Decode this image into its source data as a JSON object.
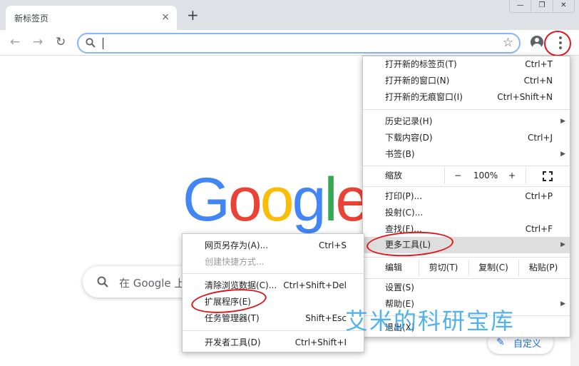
{
  "tab": {
    "title": "新标签页",
    "close": "×"
  },
  "newtab": "+",
  "window": {
    "minimize": "—",
    "restore": "❐",
    "close": "✕"
  },
  "nav": {
    "back": "←",
    "forward": "→",
    "reload": "↻",
    "star": "☆"
  },
  "page": {
    "logo": [
      "G",
      "o",
      "o",
      "g",
      "l",
      "e"
    ],
    "logo_colors": [
      "#4285f4",
      "#ea4335",
      "#fbbc05",
      "#4285f4",
      "#34a853",
      "#ea4335"
    ],
    "search_placeholder": "在 Google 上",
    "customize_label": "自定义",
    "customize_icon": "✎"
  },
  "menu": {
    "new_tab": {
      "label": "打开新的标签页(T)",
      "shortcut": "Ctrl+T"
    },
    "new_window": {
      "label": "打开新的窗口(N)",
      "shortcut": "Ctrl+N"
    },
    "incognito": {
      "label": "打开新的无痕窗口(I)",
      "shortcut": "Ctrl+Shift+N"
    },
    "history": {
      "label": "历史记录(H)"
    },
    "downloads": {
      "label": "下载内容(D)",
      "shortcut": "Ctrl+J"
    },
    "bookmarks": {
      "label": "书签(B)"
    },
    "zoom": {
      "label": "缩放",
      "minus": "−",
      "value": "100%",
      "plus": "+"
    },
    "print": {
      "label": "打印(P)...",
      "shortcut": "Ctrl+P"
    },
    "cast": {
      "label": "投射(C)..."
    },
    "find": {
      "label": "查找(F)...",
      "shortcut": "Ctrl+F"
    },
    "more_tools": {
      "label": "更多工具(L)"
    },
    "edit": {
      "label": "编辑",
      "cut": "剪切(T)",
      "copy": "复制(C)",
      "paste": "粘贴(P)"
    },
    "settings": {
      "label": "设置(S)"
    },
    "help": {
      "label": "帮助(E)"
    },
    "exit": {
      "label": "退出(X)"
    },
    "arrow": "▶"
  },
  "submenu": {
    "save_as": {
      "label": "网页另存为(A)...",
      "shortcut": "Ctrl+S"
    },
    "create_shortcut": {
      "label": "创建快捷方式..."
    },
    "clear_data": {
      "label": "清除浏览数据(C)...",
      "shortcut": "Ctrl+Shift+Del"
    },
    "extensions": {
      "label": "扩展程序(E)"
    },
    "task_manager": {
      "label": "任务管理器(T)",
      "shortcut": "Shift+Esc"
    },
    "dev_tools": {
      "label": "开发者工具(D)",
      "shortcut": "Ctrl+Shift+I"
    }
  },
  "watermark": "艾米的科研宝库",
  "colors": {
    "annotation": "#e0141b",
    "highlight": "#dedede",
    "accent": "#1a73e8",
    "watermark": "#35a6e8"
  }
}
